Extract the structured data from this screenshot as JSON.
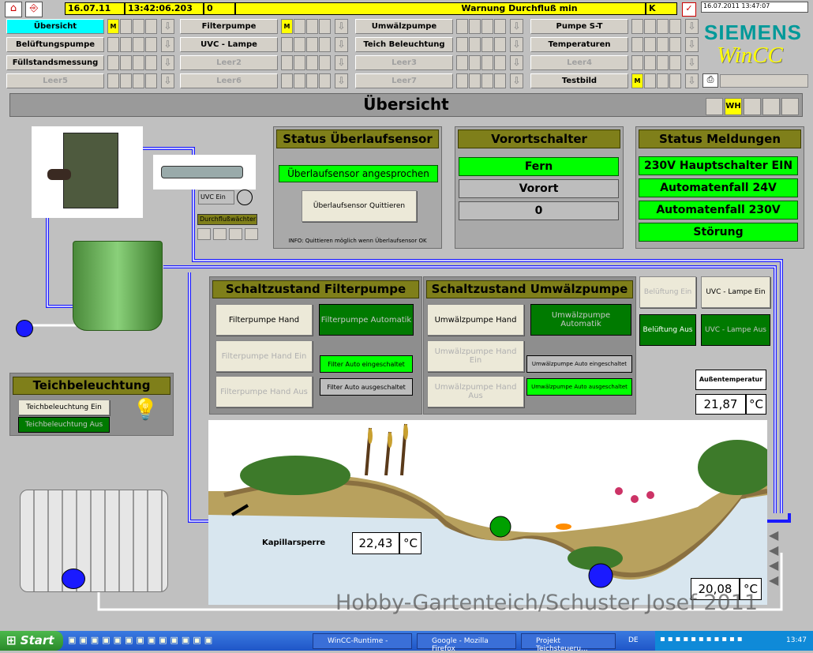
{
  "header": {
    "date": "16.07.11",
    "time": "13:42:06.203",
    "counter": "0",
    "message": "Warnung Durchfluß min",
    "flag": "K",
    "stamp": "16.07.2011 13:47:07"
  },
  "nav": {
    "row1": [
      "Übersicht",
      "Filterpumpe",
      "Umwälzpumpe",
      "Pumpe S-T"
    ],
    "row2": [
      "Belüftungspumpe",
      "UVC - Lampe",
      "Teich Beleuchtung",
      "Temperaturen"
    ],
    "row3": [
      "Füllstandsmessung",
      "Leer2",
      "Leer3",
      "Leer4"
    ],
    "row4": [
      "Leer5",
      "Leer6",
      "Leer7",
      "Testbild"
    ],
    "marker": "M"
  },
  "brand": {
    "siemens": "SIEMENS",
    "wincc": "WinCC"
  },
  "page": {
    "title": "Übersicht",
    "wh": "WH"
  },
  "overflow": {
    "title": "Status Überlaufsensor",
    "state": "Überlaufsensor angesprochen",
    "button": "Überlaufsensor Quittieren",
    "info": "INFO: Quittieren möglich wenn Überlaufsensor OK"
  },
  "local": {
    "title": "Vorortschalter",
    "fern": "Fern",
    "vorort": "Vorort",
    "value": "0"
  },
  "msgs": {
    "title": "Status Meldungen",
    "items": [
      "230V Hauptschalter EIN",
      "Automatenfall 24V",
      "Automatenfall 230V",
      "Störung"
    ]
  },
  "uvc": {
    "label": "UVC Ein",
    "flow": "Durchflußwächter"
  },
  "filter": {
    "title": "Schaltzustand Filterpumpe",
    "hand": "Filterpumpe Hand",
    "auto": "Filterpumpe Automatik",
    "handEin": "Filterpumpe Hand Ein",
    "handAus": "Filterpumpe Hand Aus",
    "autoEin": "Filter Auto eingeschaltet",
    "autoAus": "Filter Auto ausgeschaltet"
  },
  "pump": {
    "title": "Schaltzustand Umwälzpumpe",
    "hand": "Umwälzpumpe Hand",
    "auto": "Umwälzpumpe Automatik",
    "handEin": "Umwälzpumpe Hand Ein",
    "handAus": "Umwälzpumpe Hand Aus",
    "autoEin": "Umwälzpumpe Auto eingeschaltet",
    "autoAus": "Umwälzpumpe Auto ausgeschaltet"
  },
  "air": {
    "ein": "Belüftung Ein",
    "aus": "Belüftung Aus",
    "uvcEin": "UVC - Lampe Ein",
    "uvcAus": "UVC - Lampe Aus"
  },
  "temp": {
    "label": "Außentemperatur",
    "outside": "21,87",
    "unit": "°C",
    "capillary": "22,43",
    "pond": "20,08",
    "kapillar": "Kapillarsperre"
  },
  "light": {
    "title": "Teichbeleuchtung",
    "ein": "Teichbeleuchtung  Ein",
    "aus": "Teichbeleuchtung Aus"
  },
  "watermark": "Hobby-Gartenteich/Schuster Josef 2011",
  "taskbar": {
    "start": "Start",
    "items": [
      "WinCC-Runtime -",
      "Google - Mozilla Firefox",
      "Projekt Teichsteueru..."
    ],
    "lang": "DE",
    "clock": "13:47"
  },
  "colors": {
    "accent": "#00ff00",
    "title": "#7f7f1a",
    "active": "#00ffff",
    "warning": "#ffff00"
  }
}
